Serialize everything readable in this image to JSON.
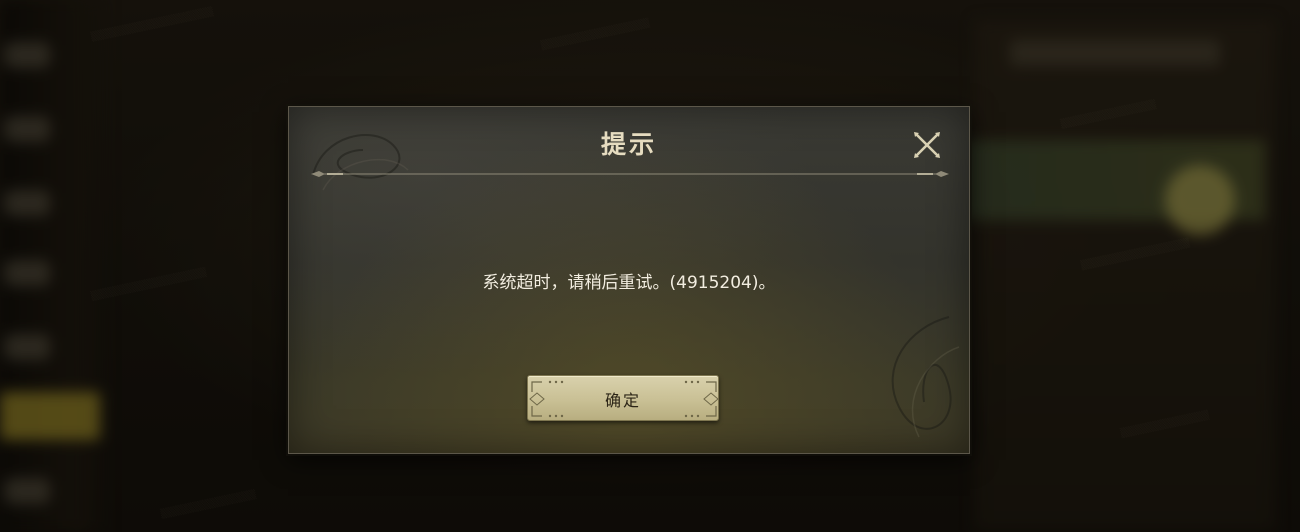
{
  "dialog": {
    "title": "提示",
    "message": "系统超时，请稍后重试。(4915204)。",
    "confirm_label": "确定",
    "close_icon": "close-x-icon"
  },
  "colors": {
    "title_text": "#e6dcc0",
    "message_text": "#f2ede0",
    "button_bg": "#d2c9a2",
    "button_text": "#2b2416",
    "highlight_tab": "#a08c28"
  }
}
